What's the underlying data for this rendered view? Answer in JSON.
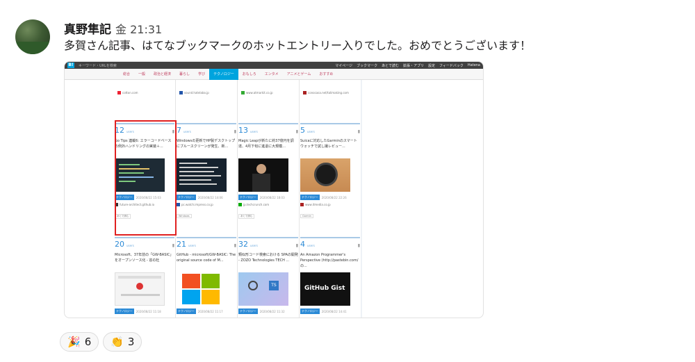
{
  "message": {
    "author": "真野隼記",
    "time": "金 21:31",
    "text": "多賀さん記事、はてなブックマークのホットエントリー入りでした。おめでとうございます！"
  },
  "hatena": {
    "top_bar": {
      "logo": "B!",
      "search_placeholder": "キーワード・URLを検索",
      "links": [
        "マイページ",
        "ブックマーク",
        "あとで読む",
        "拡張・アプリ",
        "設定",
        "フィードバック",
        "Hatena"
      ]
    },
    "nav_tabs": [
      "総合",
      "一般",
      "政治と経済",
      "暮らし",
      "学び",
      "テクノロジー",
      "おもしろ",
      "エンタメ",
      "アニメとゲーム",
      "おすすめ"
    ],
    "active_tab": "テクノロジー",
    "top_row_sources": [
      "cotton.com",
      "sound.hatelabo.jp",
      "www.atmarkit.co.jp",
      "conocasa.net/talimaking.com"
    ],
    "cards": [
      {
        "users": "12",
        "users_label": "users",
        "title": "Go Tips 連載6: エラーコードベースの例外ハンドリングの実装＋...",
        "tag": "テクノロジー",
        "date": "2020/08/22 15:03",
        "source": "future-architect.github.io",
        "chip": "あとで読む"
      },
      {
        "users": "7",
        "users_label": "users",
        "title": "Windowsの更新でHP製デスクトップにブルースクリーンが発生、新...",
        "tag": "テクノロジー",
        "date": "2020/08/22 14:06",
        "source": "pc.watch.impress.co.jp",
        "chip": "Windows"
      },
      {
        "users": "13",
        "users_label": "users",
        "title": "Magic Leapが新たに約37億円を調達、4月下旬に進退に大規模...",
        "tag": "テクノロジー",
        "date": "2020/08/22 18:03",
        "source": "jp.techcrunch.com",
        "chip": "あとで読む"
      },
      {
        "users": "5",
        "users_label": "users",
        "title": "Suicaに対応したGarminのスマートウォッチで試し撮レビュー...",
        "tag": "テクノロジー",
        "date": "2020/08/22 22:26",
        "source": "www.itmedia.co.jp",
        "chip": "Garmin"
      },
      {
        "users": "20",
        "users_label": "users",
        "title": "Microsoft、37年前の「GW-BASIC」をオープンソース化 - 窓の杜",
        "tag": "テクノロジー",
        "date": "2020/08/22 11:18",
        "source": "",
        "chip": ""
      },
      {
        "users": "21",
        "users_label": "users",
        "title": "GitHub - microsoft/GW-BASIC: The original source code of M...",
        "tag": "テクノロジー",
        "date": "2020/08/22 11:17",
        "source": "",
        "chip": ""
      },
      {
        "users": "32",
        "users_label": "users",
        "title": "類似形コード検索における SPAの開発 - ZOZO Technologies TECH ...",
        "tag": "テクノロジー",
        "date": "2020/08/22 11:32",
        "source": "",
        "chip": ""
      },
      {
        "users": "4",
        "users_label": "users",
        "title": "An Amazon Programmer's Perspective (http://pastebin.com/の...",
        "tag": "テクノロジー",
        "date": "2020/08/22 14:41",
        "source": "",
        "chip": ""
      }
    ],
    "github_gist_label": "GitHub Gist"
  },
  "reactions": [
    {
      "emoji": "🎉",
      "count": "6"
    },
    {
      "emoji": "👏",
      "count": "3"
    }
  ],
  "colors": {
    "accent": "#00a4de",
    "highlight": "#e02020",
    "count_blue": "#2b8ad6"
  }
}
